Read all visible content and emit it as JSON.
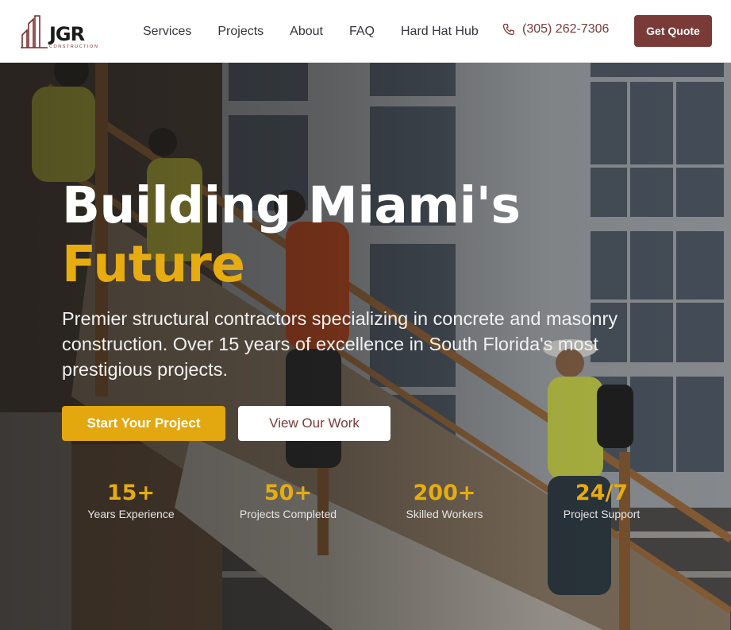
{
  "brand": {
    "logo_text": "JGR",
    "logo_subtext": "CONSTRUCTION",
    "logo_icon": "building-outline-icon",
    "accent_color": "#e7ac0f",
    "brand_color": "#7a3a38"
  },
  "nav": {
    "links": [
      "Services",
      "Projects",
      "About",
      "FAQ",
      "Hard Hat Hub"
    ],
    "phone": "(305) 262-7306",
    "phone_icon": "phone-icon",
    "quote_label": "Get Quote"
  },
  "hero": {
    "headline_line1": "Building Miami's",
    "headline_line2": "Future",
    "lead": "Premier structural contractors specializing in concrete and masonry construction. Over 15 years of excellence in South Florida's most prestigious projects.",
    "primary_cta": "Start Your Project",
    "secondary_cta": "View Our Work",
    "background": "construction workers climbing wooden stairs at building site"
  },
  "stats": [
    {
      "value": "15+",
      "label": "Years Experience"
    },
    {
      "value": "50+",
      "label": "Projects Completed"
    },
    {
      "value": "200+",
      "label": "Skilled Workers"
    },
    {
      "value": "24/7",
      "label": "Project Support"
    }
  ]
}
